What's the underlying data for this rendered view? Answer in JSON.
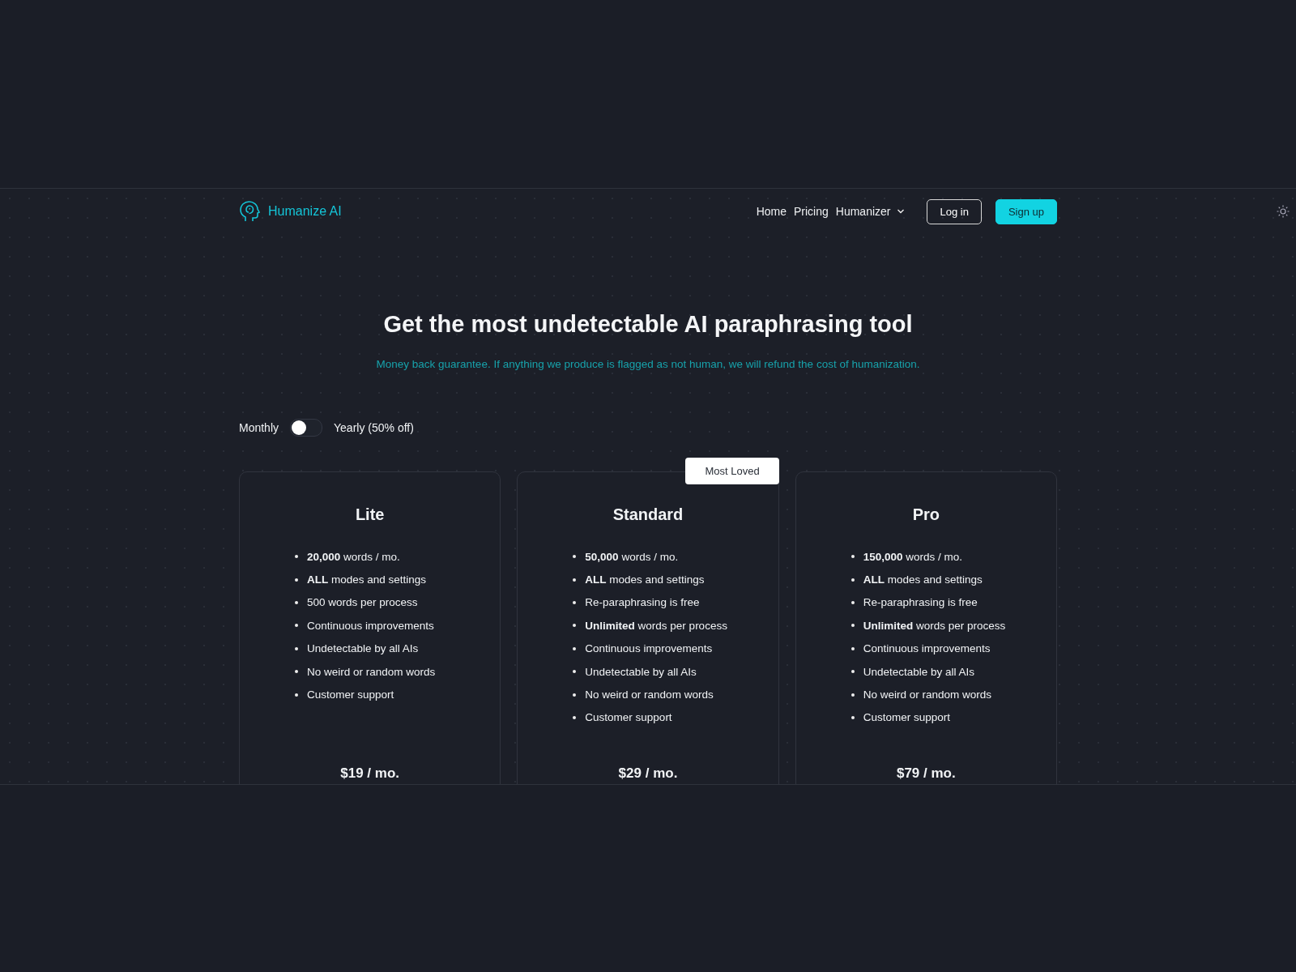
{
  "nav": {
    "brand": "Humanize AI",
    "links": [
      {
        "label": "Home",
        "kind": "link"
      },
      {
        "label": "Pricing",
        "kind": "link"
      },
      {
        "label": "Humanizer",
        "kind": "dropdown"
      }
    ],
    "buttons": [
      {
        "label": "Log in",
        "kind": "outline"
      },
      {
        "label": "Sign up",
        "kind": "primary"
      }
    ]
  },
  "hero": {
    "title": "Get the most undetectable AI paraphrasing tool",
    "subtitle": "Money back guarantee. If anything we produce is flagged as not human, we will refund the cost of humanization."
  },
  "billing": {
    "monthly_label": "Monthly",
    "yearly_label": "Yearly (50% off)",
    "on": false
  },
  "plans": [
    {
      "name": "Lite",
      "features": [
        "**20,000** words / mo.",
        "**ALL** modes and settings",
        "500 words per process",
        "Continuous improvements",
        "Undetectable by all AIs",
        "No weird or random words",
        "Customer support"
      ],
      "price": "$19 / mo."
    },
    {
      "name": "Standard",
      "badge": "Most Loved",
      "features": [
        "**50,000** words / mo.",
        "**ALL** modes and settings",
        "Re-paraphrasing is free",
        "**Unlimited** words per process",
        "Continuous improvements",
        "Undetectable by all AIs",
        "No weird or random words",
        "Customer support"
      ],
      "price": "$29 / mo."
    },
    {
      "name": "Pro",
      "features": [
        "**150,000** words / mo.",
        "**ALL** modes and settings",
        "Re-paraphrasing is free",
        "**Unlimited** words per process",
        "Continuous improvements",
        "Undetectable by all AIs",
        "No weird or random words",
        "Customer support"
      ],
      "price": "$79 / mo."
    }
  ]
}
